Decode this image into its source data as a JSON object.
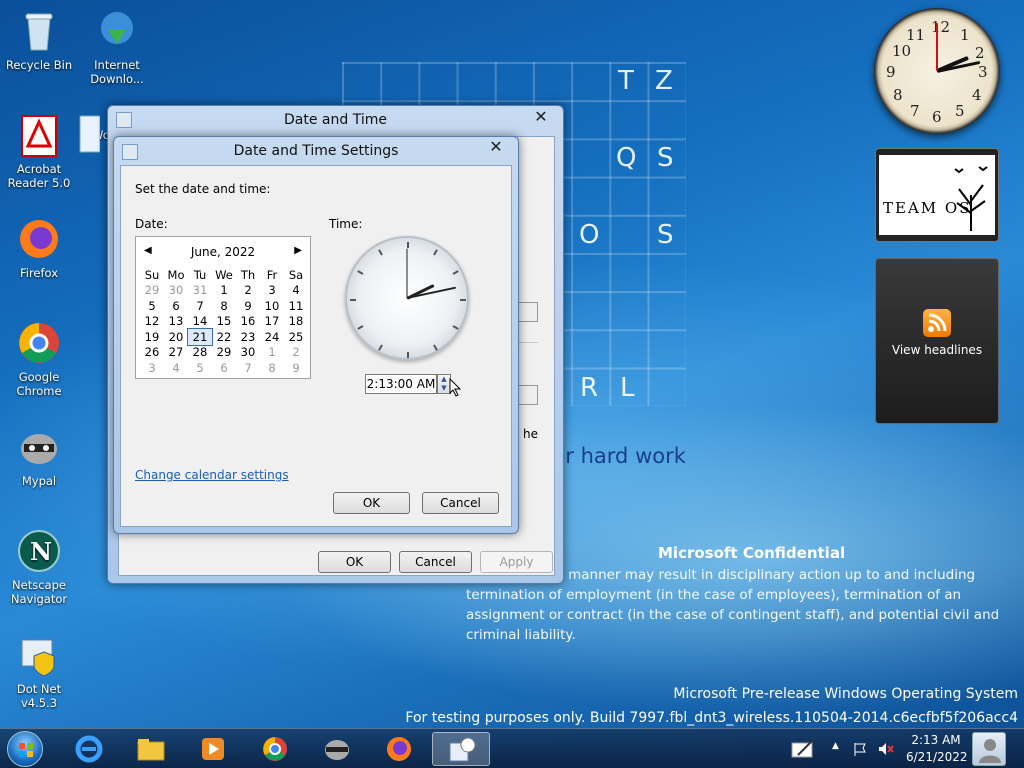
{
  "desktop": {
    "icons": [
      {
        "label": "Recycle Bin",
        "icon": "recycle-bin-icon"
      },
      {
        "label": "Internet Downlo...",
        "icon": "internet-download-manager-icon"
      },
      {
        "label": "Acrobat Reader 5.0",
        "icon": "acrobat-reader-icon"
      },
      {
        "label": "Wo",
        "icon": "document-icon"
      },
      {
        "label": "Firefox",
        "icon": "firefox-icon"
      },
      {
        "label": "Google Chrome",
        "icon": "chrome-icon"
      },
      {
        "label": "Mypal",
        "icon": "mypal-raccoon-icon"
      },
      {
        "label": "Netscape Navigator",
        "icon": "netscape-icon"
      },
      {
        "label": "Dot Net v4.5.3",
        "icon": "dotnet-installer-icon"
      }
    ],
    "grid_letters": [
      "T",
      "Z",
      "Q",
      "S",
      "O",
      "S",
      "R",
      "L"
    ],
    "wallpaper_text": "ur hard work",
    "confidential_title": "Microsoft Confidential",
    "confidential_body": "...ddure in any manner may result in disciplinary action up to and including termination of employment (in the case of employees), termination of an assignment or contract (in the case of contingent staff), and potential civil and criminal liability.",
    "watermark_line1": "Microsoft Pre-release Windows Operating System",
    "watermark_line2": "For testing purposes only. Build 7997.fbl_dnt3_wireless.110504-2014.c6ecfbf5f206acc4"
  },
  "gadgets": {
    "clock_numbers": [
      "12",
      "1",
      "2",
      "3",
      "4",
      "5",
      "6",
      "7",
      "8",
      "9",
      "10",
      "11"
    ],
    "picture_caption": "TEAM OS",
    "feed_label": "View headlines"
  },
  "outer_dialog": {
    "title": "Date and Time",
    "close": "✕",
    "peek_text": "he",
    "ok": "OK",
    "cancel": "Cancel",
    "apply": "Apply"
  },
  "dialog": {
    "title": "Date and Time Settings",
    "close": "✕",
    "instruction": "Set the date and time:",
    "date_label": "Date:",
    "time_label": "Time:",
    "calendar": {
      "month": "June, 2022",
      "prev": "◀",
      "next": "▶",
      "weekdays": [
        "Su",
        "Mo",
        "Tu",
        "We",
        "Th",
        "Fr",
        "Sa"
      ],
      "weeks": [
        [
          "29",
          "30",
          "31",
          "1",
          "2",
          "3",
          "4"
        ],
        [
          "5",
          "6",
          "7",
          "8",
          "9",
          "10",
          "11"
        ],
        [
          "12",
          "13",
          "14",
          "15",
          "16",
          "17",
          "18"
        ],
        [
          "19",
          "20",
          "21",
          "22",
          "23",
          "24",
          "25"
        ],
        [
          "26",
          "27",
          "28",
          "29",
          "30",
          "1",
          "2"
        ],
        [
          "3",
          "4",
          "5",
          "6",
          "7",
          "8",
          "9"
        ]
      ],
      "selected": "21"
    },
    "time_value": "2:13:00 AM",
    "spin_up": "▲",
    "spin_down": "▼",
    "link": "Change calendar settings",
    "ok": "OK",
    "cancel": "Cancel"
  },
  "taskbar": {
    "start": "start-orb",
    "pinned": [
      "internet-explorer-icon",
      "explorer-folder-icon",
      "media-player-icon",
      "chrome-icon",
      "mypal-raccoon-icon",
      "firefox-icon",
      "date-time-app-icon"
    ],
    "tray_time": "2:13 AM",
    "tray_date": "6/21/2022",
    "tray_arrow": "▲"
  }
}
